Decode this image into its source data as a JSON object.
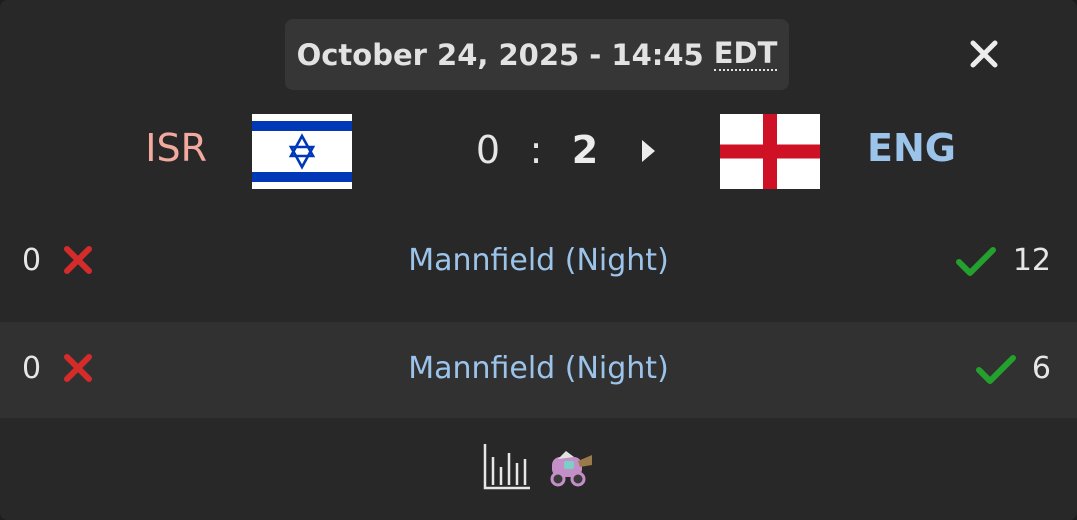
{
  "header": {
    "datetime": "October 24, 2025 - 14:45",
    "timezone": "EDT",
    "close_icon": "close-icon"
  },
  "match": {
    "team_left": {
      "code": "ISR",
      "flag": "israel-flag"
    },
    "team_right": {
      "code": "ENG",
      "flag": "england-flag"
    },
    "score_left": "0",
    "separator": ":",
    "score_right": "2",
    "expand_icon": "triangle-right-icon"
  },
  "games": [
    {
      "left_score": "0",
      "left_result": "loss",
      "map": "Mannfield (Night)",
      "right_result": "win",
      "right_score": "12"
    },
    {
      "left_score": "0",
      "left_result": "loss",
      "map": "Mannfield (Night)",
      "right_result": "win",
      "right_score": "6"
    }
  ],
  "footer": {
    "icons": [
      "stats-chart-icon",
      "car-icon"
    ]
  },
  "colors": {
    "background": "#282828",
    "pill": "#363636",
    "alt_row": "#313131",
    "team_left": "#f2a99e",
    "team_right": "#9cc3ea",
    "map_link": "#9cc3ea",
    "loss": "#d42b2b",
    "win": "#23a02d"
  }
}
